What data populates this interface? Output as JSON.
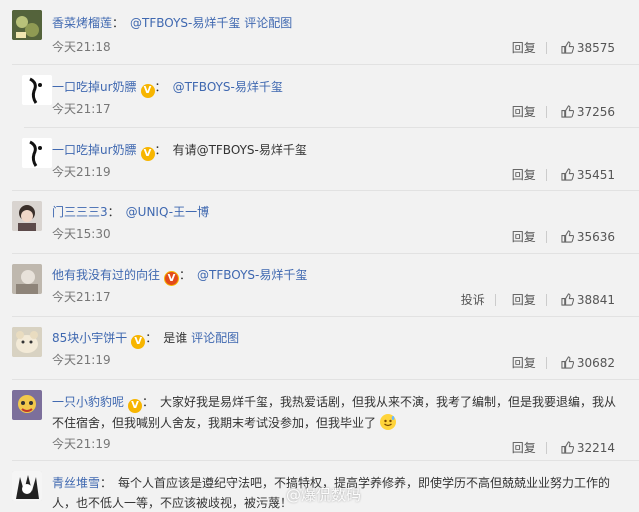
{
  "comments": [
    {
      "name": "香菜烤榴莲",
      "colon": "：",
      "text": "@TFBOYS-易烊千玺",
      "link": "评论配图",
      "time": "今天21:18",
      "reply": "回复",
      "likes": "38575"
    },
    {
      "name": "一口吃掉ur奶膘",
      "colon": "：",
      "text": "@TFBOYS-易烊千玺",
      "time": "今天21:17",
      "reply": "回复",
      "likes": "37256"
    },
    {
      "name": "一口吃掉ur奶膘",
      "colon": "：",
      "text": "有请@TFBOYS-易烊千玺",
      "time": "今天21:19",
      "reply": "回复",
      "likes": "35451"
    },
    {
      "name": "门三三三3",
      "colon": "：",
      "text": "@UNIQ-王一博",
      "time": "今天15:30",
      "reply": "回复",
      "likes": "35636"
    },
    {
      "name": "他有我没有过的向往",
      "colon": "：",
      "text": "@TFBOYS-易烊千玺",
      "time": "今天21:17",
      "report": "投诉",
      "reply": "回复",
      "likes": "38841"
    },
    {
      "name": "85块小宇饼干",
      "colon": "：",
      "text": "是谁",
      "link": "评论配图",
      "time": "今天21:19",
      "reply": "回复",
      "likes": "30682"
    },
    {
      "name": "一只小豹豹呢",
      "colon": "：",
      "text_line1": "大家好我是易烊千玺，我热爱话剧，但我从来不演，我考了编制，但是我要退编，我从",
      "text_line2": "不住宿舍，但我喊别人舍友，我期末考试没参加，但我毕业了",
      "time": "今天21:19",
      "reply": "回复",
      "likes": "32214"
    },
    {
      "name": "青丝堆雪",
      "colon": "：",
      "text_line1": "每个人首应该是遵纪守法吧，不搞特权，提高学养修养，即使学历不高但兢兢业业努力工作的",
      "text_line2": "人，也不低人一等，不应该被歧视，被污蔑！"
    }
  ],
  "watermark": "@爆侃数码",
  "colors": {
    "link": "#3f68b0",
    "background": "#f2f2f2",
    "vip_badge": "#f7b500"
  }
}
